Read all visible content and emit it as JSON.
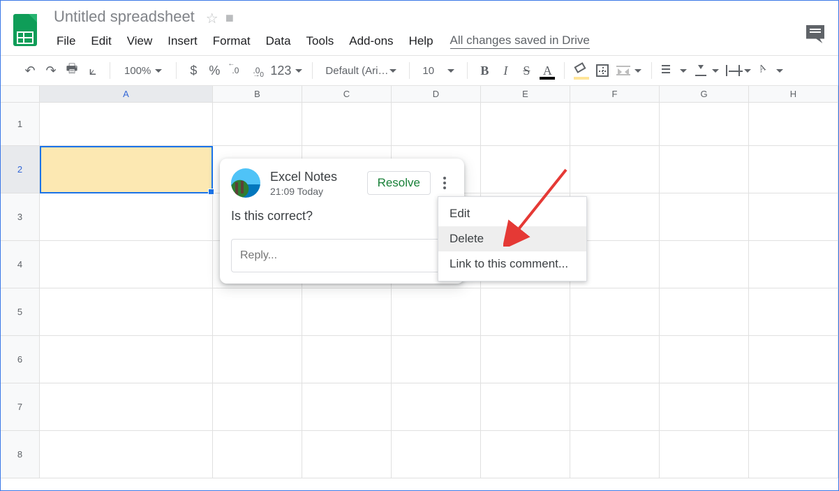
{
  "doc": {
    "title": "Untitled spreadsheet",
    "drive_status": "All changes saved in Drive"
  },
  "menus": {
    "file": "File",
    "edit": "Edit",
    "view": "View",
    "insert": "Insert",
    "format": "Format",
    "data": "Data",
    "tools": "Tools",
    "addons": "Add-ons",
    "help": "Help"
  },
  "toolbar": {
    "zoom": "100%",
    "font": "Default (Ari…",
    "font_size": "10",
    "currency": "$",
    "percent": "%",
    "dec_dec": ".0",
    "inc_dec": ".00",
    "more_fmt": "123",
    "bold": "B",
    "italic": "I",
    "strike": "S",
    "textcolor": "A"
  },
  "columns": [
    "A",
    "B",
    "C",
    "D",
    "E",
    "F",
    "G",
    "H"
  ],
  "rows": [
    "1",
    "2",
    "3",
    "4",
    "5",
    "6",
    "7",
    "8"
  ],
  "comment": {
    "author": "Excel Notes",
    "time": "21:09 Today",
    "body": "Is this correct?",
    "resolve": "Resolve",
    "reply_placeholder": "Reply..."
  },
  "ctx": {
    "edit": "Edit",
    "delete": "Delete",
    "link": "Link to this comment..."
  }
}
